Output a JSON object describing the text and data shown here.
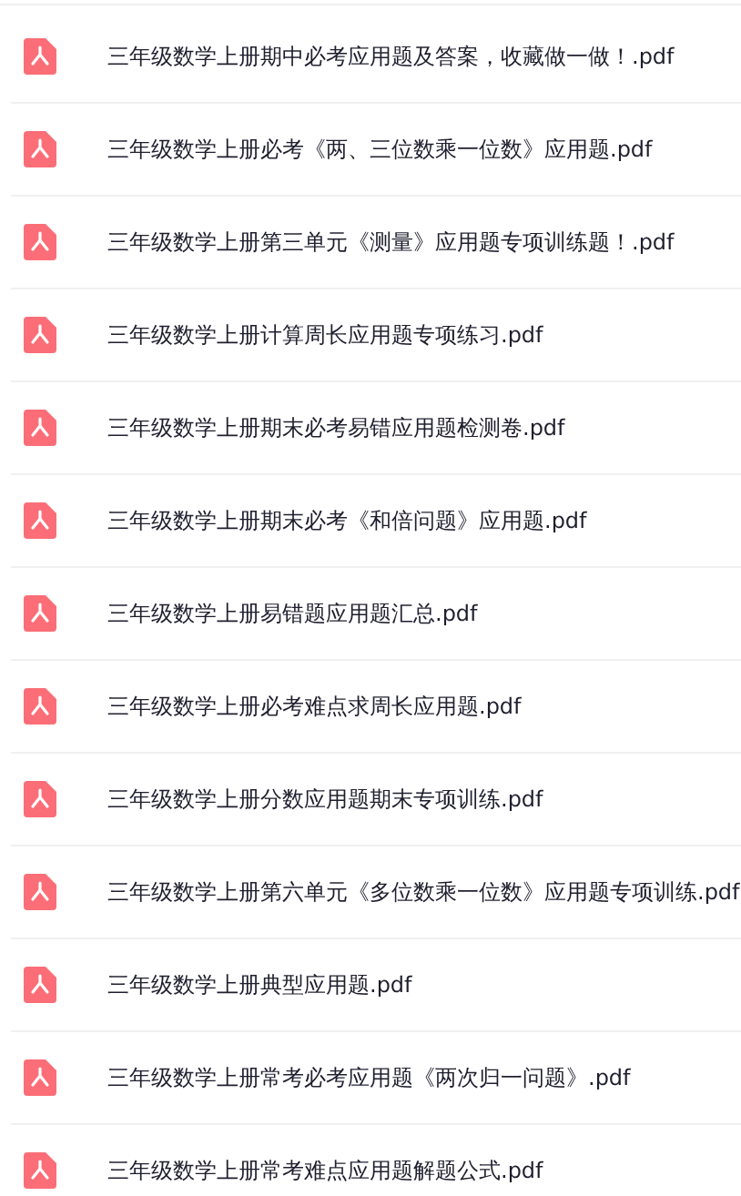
{
  "files": [
    {
      "name": "三年级数学上册期中必考应用题及答案，收藏做一做！.pdf",
      "kind": "pdf"
    },
    {
      "name": "三年级数学上册必考《两、三位数乘一位数》应用题.pdf",
      "kind": "pdf"
    },
    {
      "name": "三年级数学上册第三单元《测量》应用题专项训练题！.pdf",
      "kind": "pdf"
    },
    {
      "name": "三年级数学上册计算周长应用题专项练习.pdf",
      "kind": "pdf"
    },
    {
      "name": "三年级数学上册期末必考易错应用题检测卷.pdf",
      "kind": "pdf"
    },
    {
      "name": "三年级数学上册期末必考《和倍问题》应用题.pdf",
      "kind": "pdf"
    },
    {
      "name": "三年级数学上册易错题应用题汇总.pdf",
      "kind": "pdf"
    },
    {
      "name": "三年级数学上册必考难点求周长应用题.pdf",
      "kind": "pdf"
    },
    {
      "name": "三年级数学上册分数应用题期末专项训练.pdf",
      "kind": "pdf"
    },
    {
      "name": "三年级数学上册第六单元《多位数乘一位数》应用题专项训练.pdf",
      "kind": "pdf"
    },
    {
      "name": "三年级数学上册典型应用题.pdf",
      "kind": "pdf"
    },
    {
      "name": "三年级数学上册常考必考应用题《两次归一问题》.pdf",
      "kind": "pdf"
    },
    {
      "name": "三年级数学上册常考难点应用题解题公式.pdf",
      "kind": "pdf"
    }
  ]
}
